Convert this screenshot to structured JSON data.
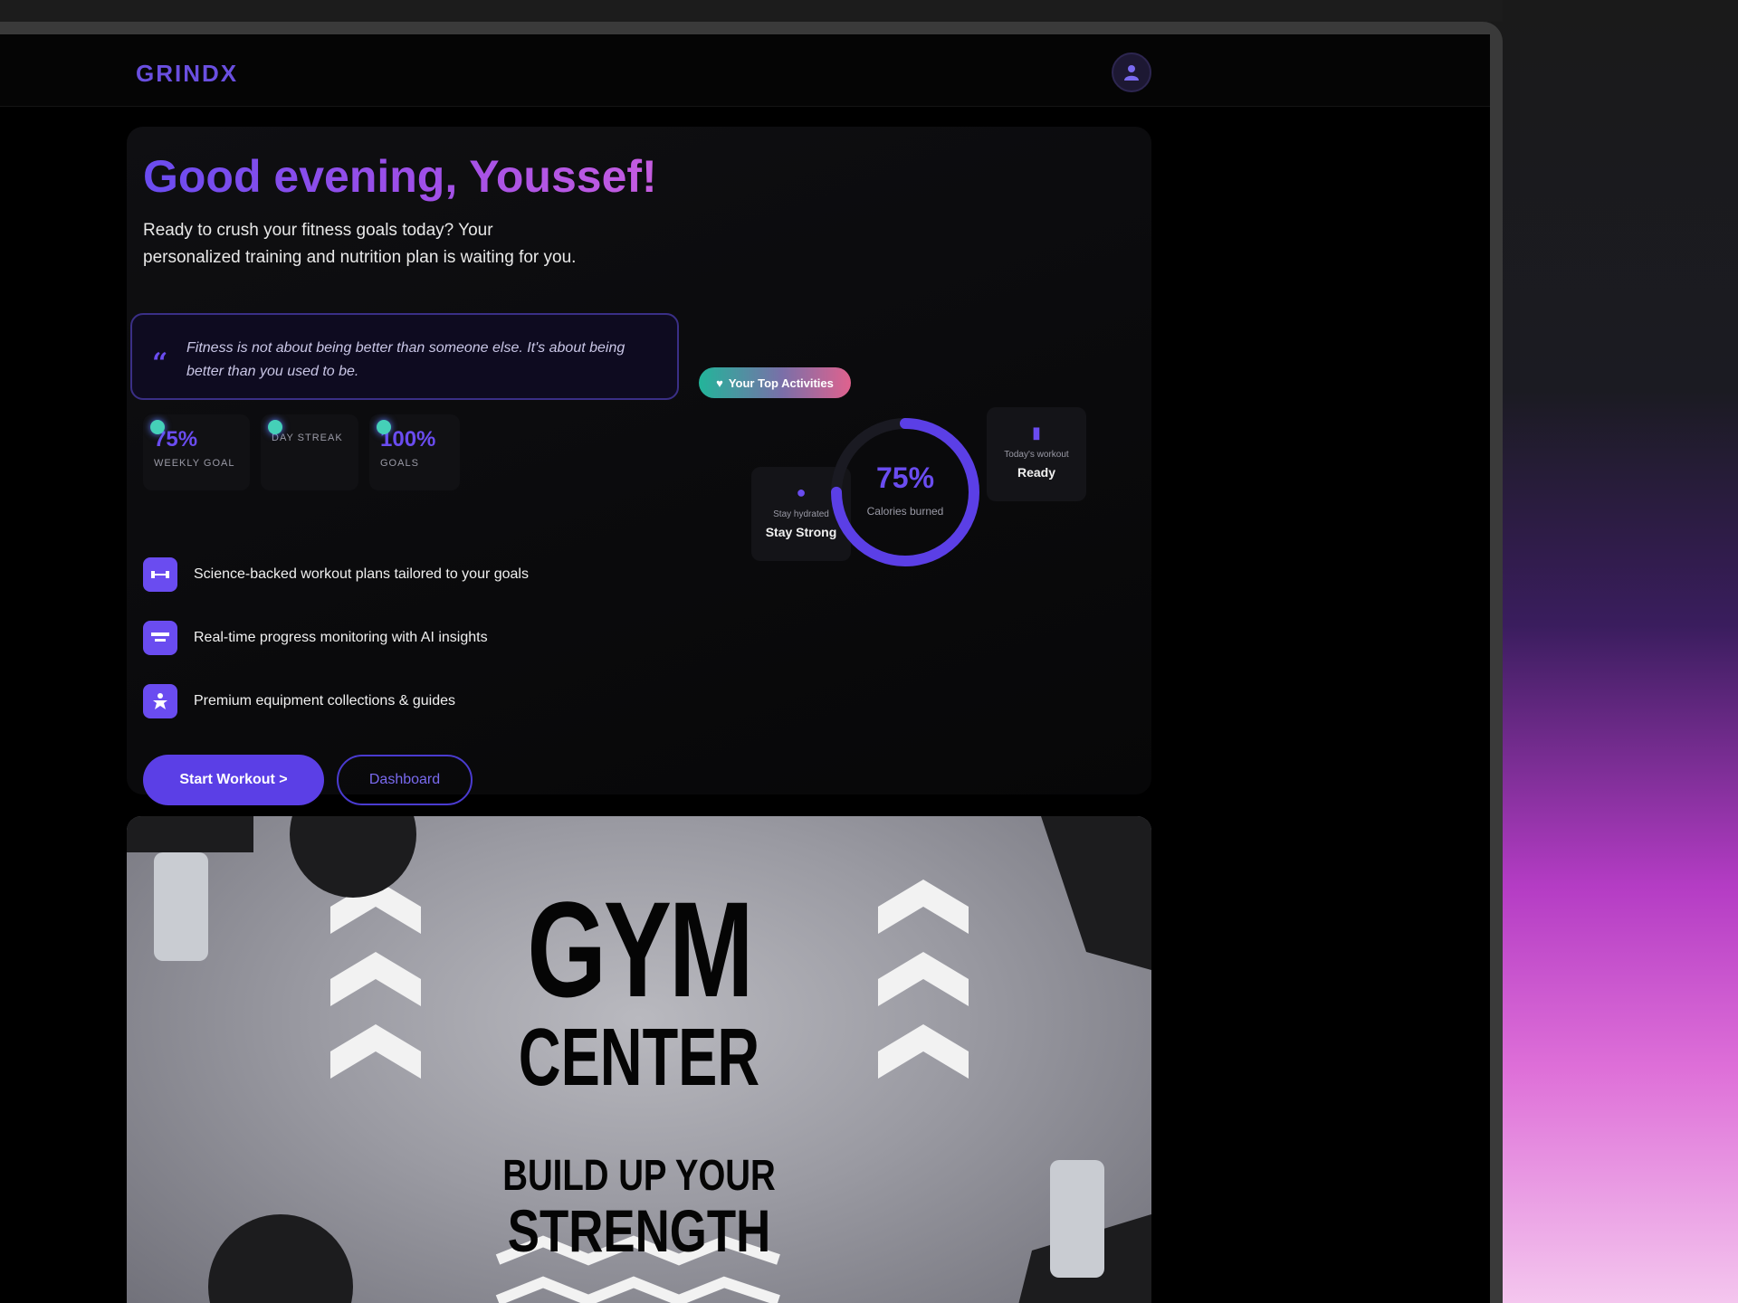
{
  "brand": {
    "logo": "GRINDX"
  },
  "hero": {
    "greeting": "Good evening, Youssef!",
    "subtitle": "Ready to crush your fitness goals today? Your personalized training and nutrition plan is waiting for you.",
    "quote": "Fitness is not about being better than someone else. It's about being better than you used to be.",
    "stats": [
      {
        "value": "75%",
        "label": "WEEKLY GOAL"
      },
      {
        "value": "",
        "label": "DAY STREAK"
      },
      {
        "value": "100%",
        "label": "GOALS"
      }
    ],
    "features": [
      {
        "icon": "dumbbell-icon",
        "text": "Science-backed workout plans tailored to your goals"
      },
      {
        "icon": "chart-icon",
        "text": "Real-time progress monitoring with AI insights"
      },
      {
        "icon": "equipment-icon",
        "text": "Premium equipment collections & guides"
      }
    ],
    "primary_button": "Start Workout >",
    "secondary_button": "Dashboard"
  },
  "widget": {
    "badge": "Your Top Activities",
    "ring": {
      "value": "75%",
      "label": "Calories burned",
      "progress": 0.75
    },
    "left_card": {
      "sub": "Stay hydrated",
      "value": "Stay Strong"
    },
    "right_card": {
      "sub": "Today's workout",
      "value": "Ready"
    }
  },
  "banner": {
    "line1": "GYM",
    "line2": "CENTER",
    "line3": "BUILD UP YOUR",
    "line4": "STRENGTH"
  },
  "colors": {
    "accent": "#6a4cf0",
    "background": "#000000",
    "card": "#0f0f12"
  }
}
